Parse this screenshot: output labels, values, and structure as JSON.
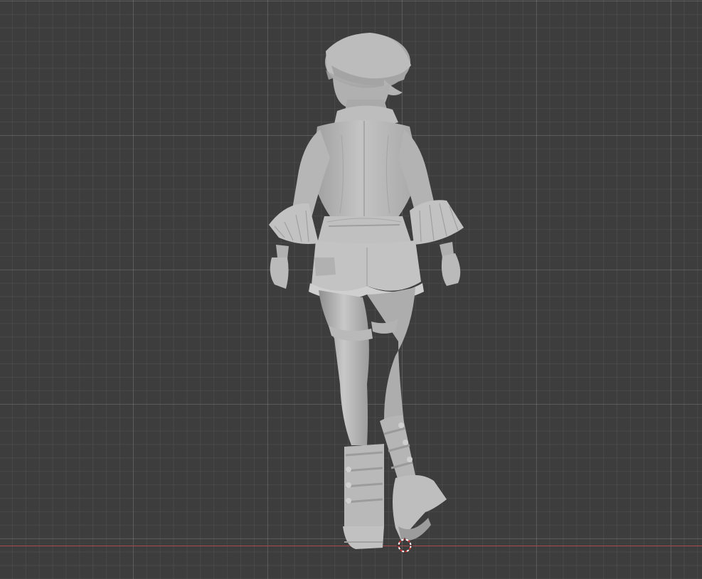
{
  "viewport": {
    "background": "#3d3d3d",
    "grid_visible": true,
    "x_axis_color": "#a64a4e",
    "model_color": "#bdbdbd"
  },
  "scene": {
    "object_description_icon": "figure-model-icon",
    "cursor_icon": "3d-cursor-icon"
  }
}
